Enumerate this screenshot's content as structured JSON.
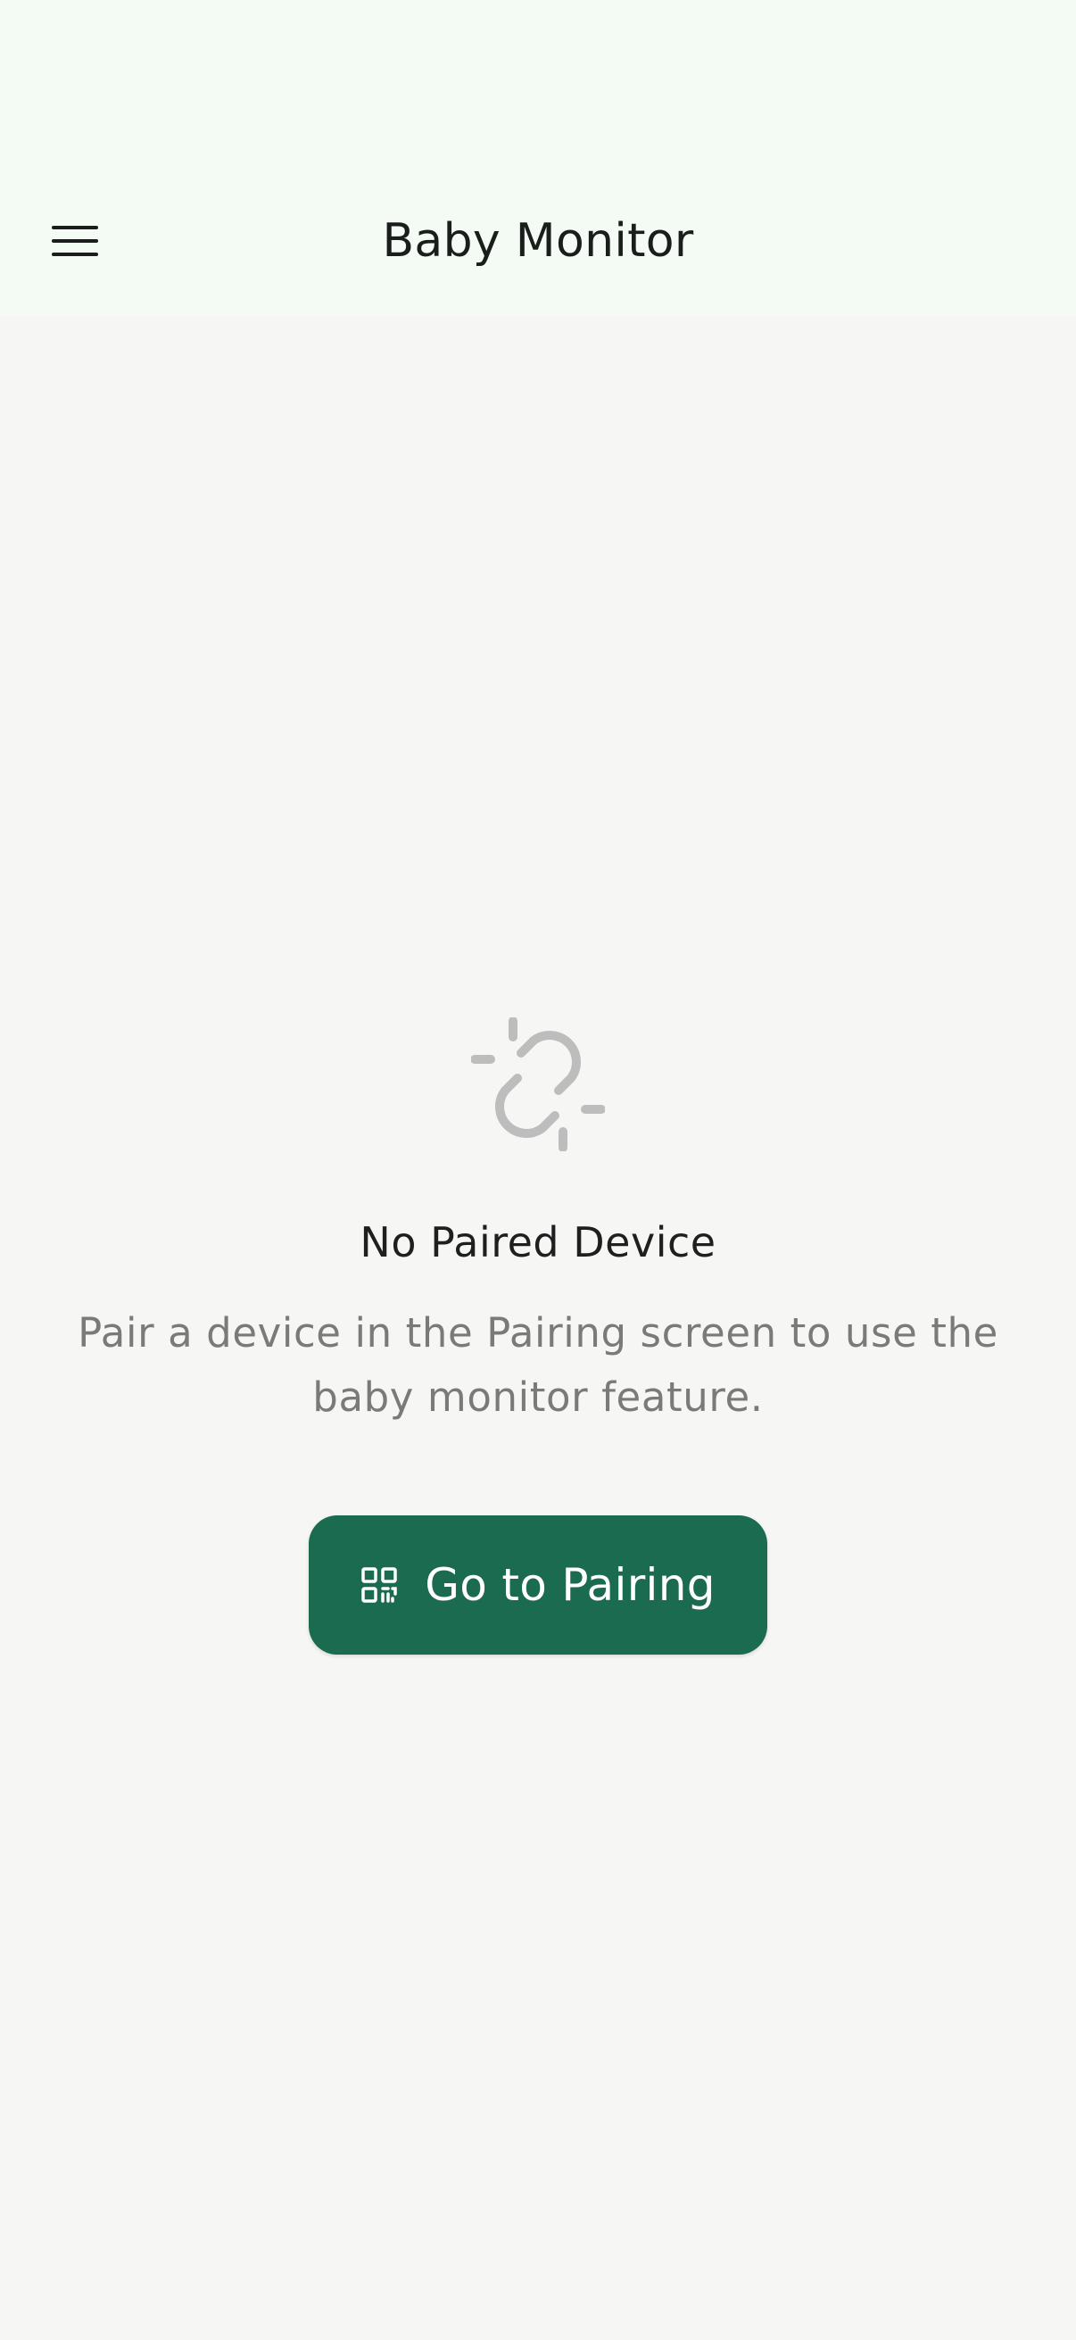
{
  "app_bar": {
    "title": "Baby Monitor",
    "menu_icon": "hamburger-menu-icon",
    "background": "#f3fbf4"
  },
  "empty_state": {
    "icon": "link-off-icon",
    "title": "No Paired Device",
    "description": "Pair a device in the Pairing screen to use the baby monitor feature."
  },
  "pair_button": {
    "label": "Go to Pairing",
    "icon": "qr-code-icon",
    "color": "#1b6b50"
  },
  "colors": {
    "background": "#f6f6f4",
    "icon_gray": "#bdbdbd",
    "text_dark": "#1e201f",
    "text_muted": "#7a7a78"
  }
}
